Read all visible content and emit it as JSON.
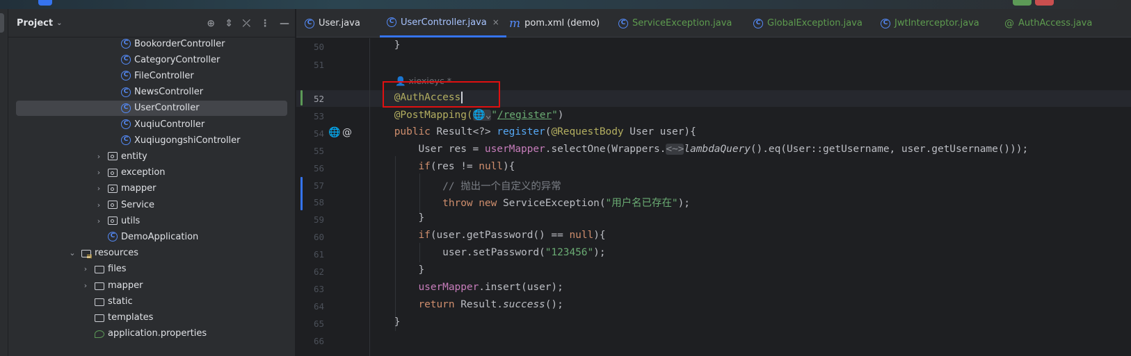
{
  "sidebar": {
    "title": "Project",
    "tree": [
      {
        "label": "BookorderController",
        "type": "class",
        "indent": 3
      },
      {
        "label": "CategoryController",
        "type": "class",
        "indent": 3
      },
      {
        "label": "FileController",
        "type": "class",
        "indent": 3
      },
      {
        "label": "NewsController",
        "type": "class",
        "indent": 3
      },
      {
        "label": "UserController",
        "type": "class",
        "indent": 3,
        "selected": true
      },
      {
        "label": "XuqiuController",
        "type": "class",
        "indent": 3
      },
      {
        "label": "XuqiugongshiController",
        "type": "class",
        "indent": 3
      },
      {
        "label": "entity",
        "type": "package",
        "indent": 2,
        "arrow": "collapsed"
      },
      {
        "label": "exception",
        "type": "package",
        "indent": 2,
        "arrow": "collapsed"
      },
      {
        "label": "mapper",
        "type": "package",
        "indent": 2,
        "arrow": "collapsed"
      },
      {
        "label": "Service",
        "type": "package",
        "indent": 2,
        "arrow": "collapsed"
      },
      {
        "label": "utils",
        "type": "package",
        "indent": 2,
        "arrow": "collapsed"
      },
      {
        "label": "DemoApplication",
        "type": "class",
        "indent": 2
      },
      {
        "label": "resources",
        "type": "resources",
        "indent": 0,
        "arrow": "expanded"
      },
      {
        "label": "files",
        "type": "folder",
        "indent": 1,
        "arrow": "collapsed"
      },
      {
        "label": "mapper",
        "type": "folder",
        "indent": 1,
        "arrow": "collapsed"
      },
      {
        "label": "static",
        "type": "folder",
        "indent": 1
      },
      {
        "label": "templates",
        "type": "folder",
        "indent": 1
      },
      {
        "label": "application.properties",
        "type": "properties",
        "indent": 1
      }
    ]
  },
  "tabs": [
    {
      "label": "User.java",
      "icon": "class"
    },
    {
      "label": "UserController.java",
      "icon": "class",
      "active": true
    },
    {
      "label": "pom.xml (demo)",
      "icon": "maven"
    },
    {
      "label": "ServiceException.java",
      "icon": "class",
      "green": true
    },
    {
      "label": "GlobalException.java",
      "icon": "class",
      "green": true
    },
    {
      "label": "JwtInterceptor.java",
      "icon": "class",
      "green": true
    },
    {
      "label": "AuthAccess.java",
      "icon": "annotation",
      "green": true
    }
  ],
  "editor": {
    "author_hint": "xiexieyc *",
    "current_line": 52,
    "lines": [
      {
        "n": "50",
        "t": [
          [
            "    }",
            ""
          ]
        ]
      },
      {
        "n": "51",
        "t": []
      },
      {
        "n": "52",
        "t": [
          [
            "    @AuthAccess",
            "an"
          ]
        ]
      },
      {
        "n": "53",
        "t": [
          [
            "    @PostMapping(",
            "an"
          ],
          [
            "🌐⌄",
            "hint"
          ],
          [
            "\"",
            "st"
          ],
          [
            "/register",
            "st ul"
          ],
          [
            "\"",
            "st"
          ],
          [
            ")",
            ""
          ]
        ]
      },
      {
        "n": "54",
        "t": [
          [
            "    public ",
            "kw"
          ],
          [
            "Result<?> ",
            ""
          ],
          [
            "register",
            "fn"
          ],
          [
            "(",
            ""
          ],
          [
            "@RequestBody ",
            "an"
          ],
          [
            "User user){",
            ""
          ]
        ]
      },
      {
        "n": "55",
        "t": [
          [
            "        User res = ",
            ""
          ],
          [
            "userMapper",
            "fd"
          ],
          [
            ".selectOne(Wrappers.",
            ""
          ],
          [
            "<~>",
            "hint"
          ],
          [
            "lambdaQuery",
            "it"
          ],
          [
            "().eq(User::getUsername, user.getUsername()));",
            ""
          ]
        ]
      },
      {
        "n": "56",
        "t": [
          [
            "        if",
            "kw"
          ],
          [
            "(res != ",
            ""
          ],
          [
            "null",
            "kw"
          ],
          [
            "){",
            ""
          ]
        ]
      },
      {
        "n": "57",
        "t": [
          [
            "            // 抛出一个自定义的异常",
            "cm"
          ]
        ]
      },
      {
        "n": "58",
        "t": [
          [
            "            throw new ",
            "kw"
          ],
          [
            "ServiceException(",
            ""
          ],
          [
            "\"用户名已存在\"",
            "st"
          ],
          [
            ");",
            ""
          ]
        ]
      },
      {
        "n": "59",
        "t": [
          [
            "        }",
            ""
          ]
        ]
      },
      {
        "n": "60",
        "t": [
          [
            "        if",
            "kw"
          ],
          [
            "(user.getPassword() == ",
            ""
          ],
          [
            "null",
            "kw"
          ],
          [
            "){",
            ""
          ]
        ]
      },
      {
        "n": "61",
        "t": [
          [
            "            user.setPassword(",
            ""
          ],
          [
            "\"123456\"",
            "st"
          ],
          [
            ");",
            ""
          ]
        ]
      },
      {
        "n": "62",
        "t": [
          [
            "        }",
            ""
          ]
        ]
      },
      {
        "n": "63",
        "t": [
          [
            "        ",
            ""
          ],
          [
            "userMapper",
            "fd"
          ],
          [
            ".insert(user);",
            ""
          ]
        ]
      },
      {
        "n": "64",
        "t": [
          [
            "        return ",
            "kw"
          ],
          [
            "Result.",
            ""
          ],
          [
            "success",
            "it"
          ],
          [
            "();",
            ""
          ]
        ]
      },
      {
        "n": "65",
        "t": [
          [
            "    }",
            ""
          ]
        ]
      },
      {
        "n": "66",
        "t": []
      }
    ]
  },
  "colors": {
    "accent": "#3574f0",
    "highlight_box": "#e01010",
    "added": "#5c9a57",
    "modified": "#3574f0"
  }
}
